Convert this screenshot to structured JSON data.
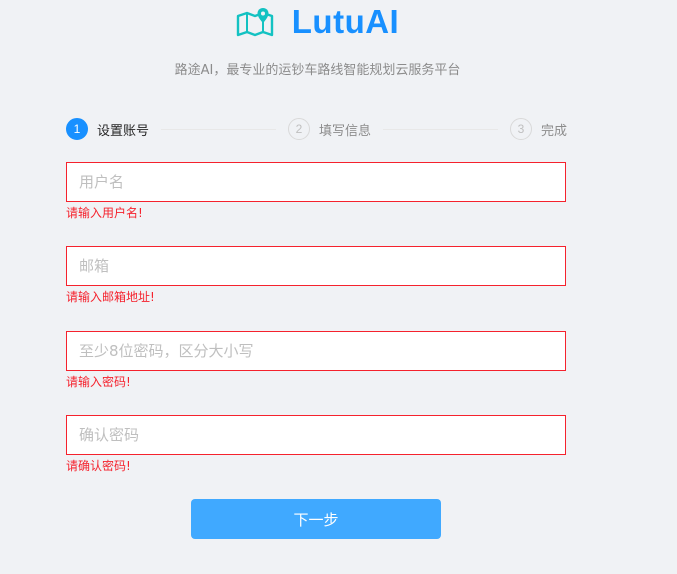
{
  "brand": {
    "name": "LutuAI",
    "tagline": "路途AI，最专业的运钞车路线智能规划云服务平台",
    "accent_color": "#1890ff"
  },
  "steps": [
    {
      "number": "1",
      "label": "设置账号",
      "status": "active"
    },
    {
      "number": "2",
      "label": "填写信息",
      "status": "wait"
    },
    {
      "number": "3",
      "label": "完成",
      "status": "wait"
    }
  ],
  "form": {
    "username": {
      "value": "",
      "placeholder": "用户名",
      "error": "请输入用户名!"
    },
    "email": {
      "value": "",
      "placeholder": "邮箱",
      "error": "请输入邮箱地址!"
    },
    "password": {
      "value": "",
      "placeholder": "至少8位密码，区分大小写",
      "error": "请输入密码!"
    },
    "confirm_password": {
      "value": "",
      "placeholder": "确认密码",
      "error": "请确认密码!"
    },
    "error_color": "#f5222d"
  },
  "actions": {
    "next_label": "下一步",
    "button_color": "#40a9ff"
  },
  "icons": {
    "logo": "map-pin-icon"
  }
}
